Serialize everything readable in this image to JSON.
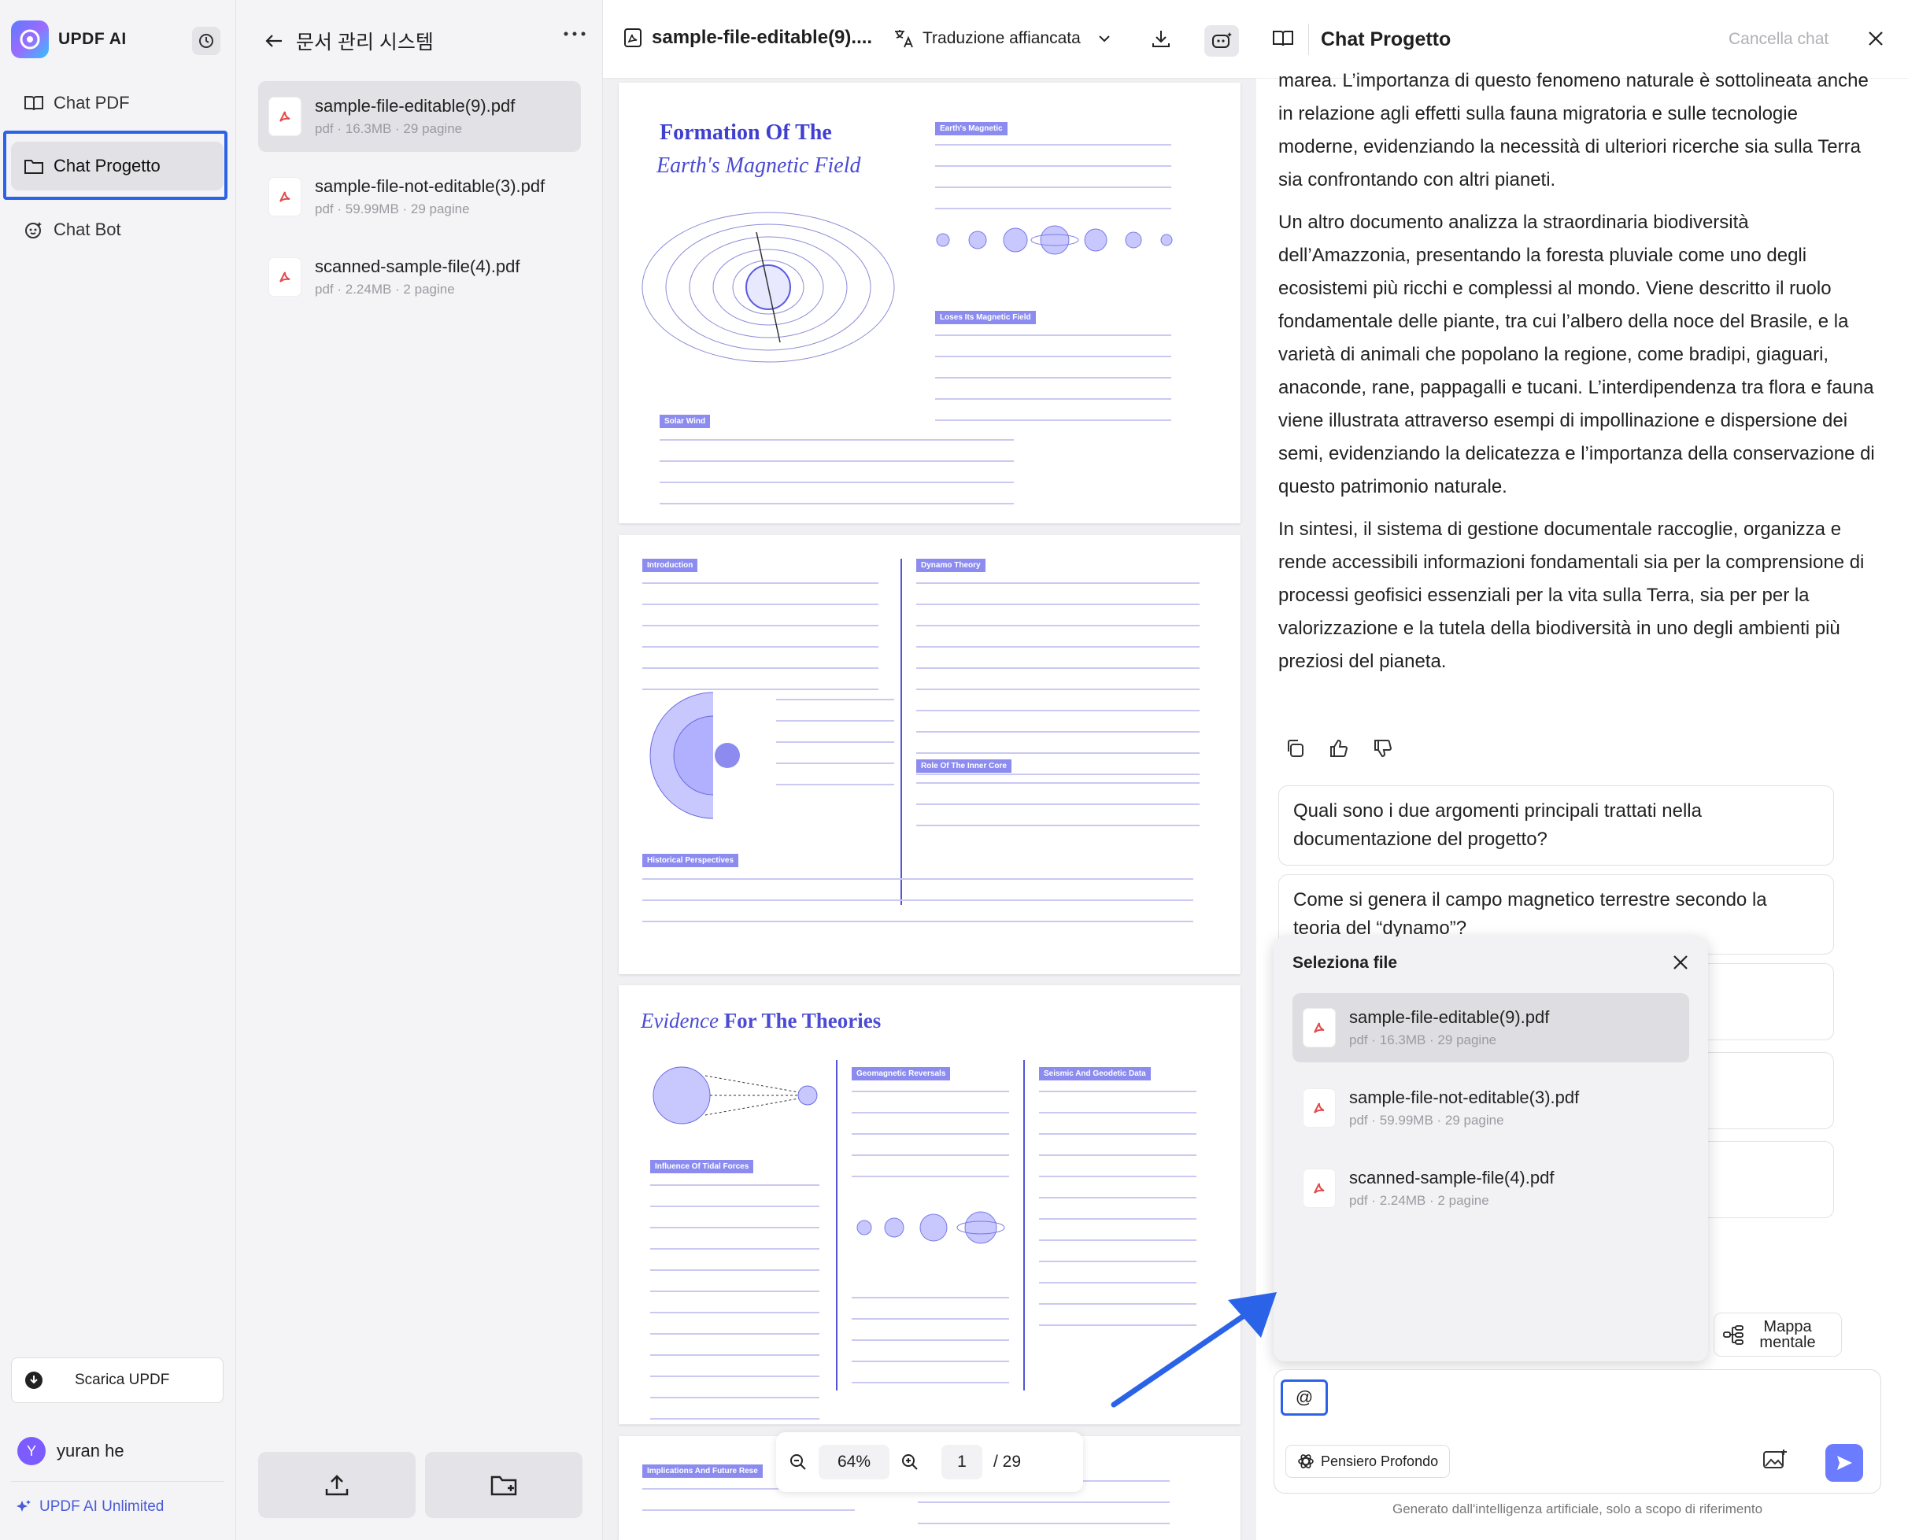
{
  "sidebar": {
    "app_title": "UPDF AI",
    "nav": [
      {
        "label": "Chat PDF",
        "icon": "book-icon"
      },
      {
        "label": "Chat Progetto",
        "icon": "folder-icon"
      },
      {
        "label": "Chat Bot",
        "icon": "bot-icon"
      }
    ],
    "download_label": "Scarica UPDF",
    "user": {
      "initial": "Y",
      "name": "yuran he"
    },
    "unlimited_label": "UPDF AI Unlimited",
    "accent_color": "#2b63e8"
  },
  "filepanel": {
    "title": "문서 관리 시스템",
    "files": [
      {
        "name": "sample-file-editable(9).pdf",
        "meta": "pdf · 16.3MB · 29 pagine"
      },
      {
        "name": "sample-file-not-editable(3).pdf",
        "meta": "pdf · 59.99MB · 29 pagine"
      },
      {
        "name": "scanned-sample-file(4).pdf",
        "meta": "pdf · 2.24MB · 2 pagine"
      }
    ]
  },
  "viewer": {
    "file_title": "sample-file-editable(9)....",
    "translate_label": "Traduzione affiancata",
    "zoom": "64%",
    "page_current": "1",
    "page_total": "/ 29",
    "page1": {
      "title": "Formation Of The",
      "subtitle": "Earth's Magnetic Field",
      "tags": [
        "Earth's Magnetic",
        "Loses Its Magnetic Field",
        "Solar Wind"
      ]
    },
    "page2": {
      "tags": [
        "Introduction",
        "Dynamo Theory",
        "Role Of The Inner Core",
        "Historical Perspectives"
      ]
    },
    "page3": {
      "title_italic": "Evidence",
      "title_bold": "For The Theories",
      "tags": [
        "Geomagnetic Reversals",
        "Seismic And Geodetic Data",
        "Influence Of Tidal Forces"
      ]
    },
    "page4": {
      "tags": [
        "Implications And Future Rese"
      ]
    }
  },
  "chat": {
    "title": "Chat Progetto",
    "clear_label": "Cancella chat",
    "paragraphs": [
      "marea. L’importanza di questo fenomeno naturale è sottolineata anche in relazione agli effetti sulla fauna migratoria e sulle tecnologie moderne, evidenziando la necessità di ulteriori ricerche sia sulla Terra sia confrontando con altri pianeti.",
      "Un altro documento analizza la straordinaria biodiversità dell’Amazzonia, presentando la foresta pluviale come uno degli ecosistemi più ricchi e complessi al mondo. Viene descritto il ruolo fondamentale delle piante, tra cui l’albero della noce del Brasile, e la varietà di animali che popolano la regione, come bradipi, giaguari, anaconde, rane, pappagalli e tucani. L’interdipendenza tra flora e fauna viene illustrata attraverso esempi di impollinazione e dispersione dei semi, evidenziando la delicatezza e l’importanza della conservazione di questo patrimonio naturale.",
      "In sintesi, il sistema di gestione documentale raccoglie, organizza e rende accessibili informazioni fondamentali sia per la comprensione di processi geofisici essenziali per la vita sulla Terra, sia per per la valorizzazione e la tutela della biodiversità in uno degli ambienti più preziosi del pianeta."
    ],
    "suggestions": [
      "Quali sono i due argomenti principali trattati nella documentazione del progetto?",
      "Come si genera il campo magnetico terrestre secondo la teoria del “dynamo”?",
      "ntesto della",
      "lla",
      "a della"
    ],
    "mappa_label": "Mappa mentale",
    "popup": {
      "title": "Seleziona file",
      "files": [
        {
          "name": "sample-file-editable(9).pdf",
          "meta": "pdf · 16.3MB · 29 pagine"
        },
        {
          "name": "sample-file-not-editable(3).pdf",
          "meta": "pdf · 59.99MB · 29 pagine"
        },
        {
          "name": "scanned-sample-file(4).pdf",
          "meta": "pdf · 2.24MB · 2 pagine"
        }
      ]
    },
    "input": {
      "value": "@"
    },
    "deep_label": "Pensiero Profondo",
    "disclaimer": "Generato dall'intelligenza artificiale, solo a scopo di riferimento"
  }
}
